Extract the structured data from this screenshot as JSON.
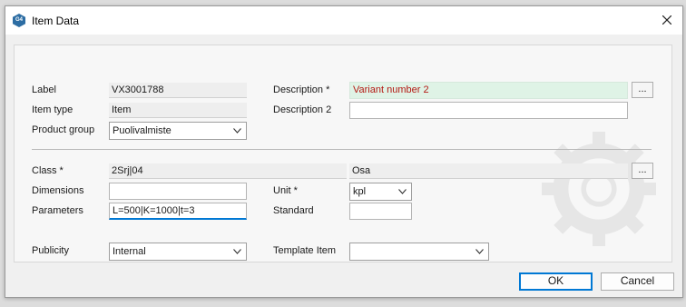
{
  "window": {
    "title": "Item Data",
    "app_icon": "G4"
  },
  "labels": {
    "label": "Label",
    "item_type": "Item type",
    "product_group": "Product group",
    "description": "Description *",
    "description2": "Description 2",
    "class": "Class *",
    "dimensions": "Dimensions",
    "parameters": "Parameters",
    "unit": "Unit *",
    "standard": "Standard",
    "publicity": "Publicity",
    "template_item": "Template Item"
  },
  "values": {
    "label": "VX3001788",
    "item_type": "Item",
    "product_group": "Puolivalmiste",
    "description": "Variant number 2",
    "description2": "",
    "class_code": "2Srj|04",
    "class_name": "Osa",
    "dimensions": "",
    "parameters": "L=500|K=1000|t=3",
    "unit": "kpl",
    "standard": "",
    "publicity": "Internal",
    "template_item": ""
  },
  "buttons": {
    "browse": "...",
    "ok": "OK",
    "cancel": "Cancel"
  },
  "colors": {
    "description_bg": "#dff3e6",
    "description_text": "#b41a14",
    "accent": "#0078d4"
  },
  "icons": {
    "close": "close-icon",
    "dropdown": "chevron-down-icon",
    "app": "g4-app-icon"
  }
}
